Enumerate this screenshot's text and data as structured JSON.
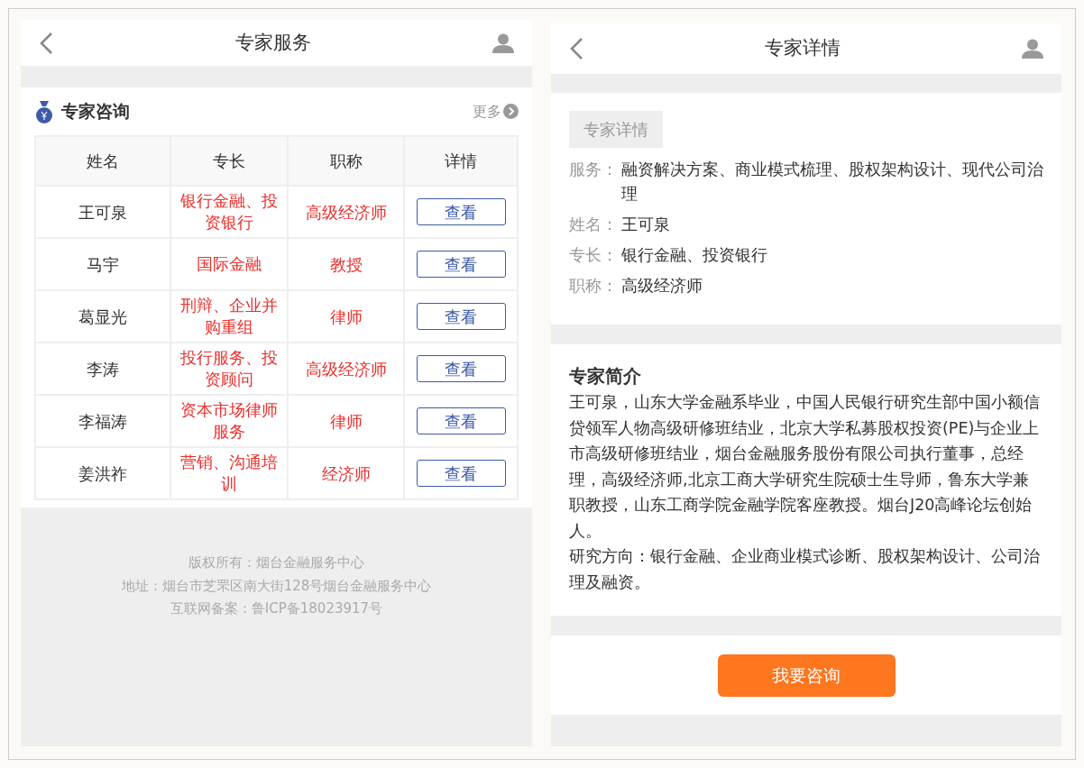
{
  "list_screen": {
    "header": {
      "title": "专家服务"
    },
    "section": {
      "title": "专家咨询",
      "more": "更多"
    },
    "table": {
      "columns": [
        "姓名",
        "专长",
        "职称",
        "详情"
      ],
      "rows": [
        {
          "name": "王可泉",
          "specialty": "银行金融、投资银行",
          "title": "高级经济师",
          "action": "查看"
        },
        {
          "name": "马宇",
          "specialty": "国际金融",
          "title": "教授",
          "action": "查看"
        },
        {
          "name": "葛显光",
          "specialty": "刑辩、企业并购重组",
          "title": "律师",
          "action": "查看"
        },
        {
          "name": "李涛",
          "specialty": "投行服务、投资顾问",
          "title": "高级经济师",
          "action": "查看"
        },
        {
          "name": "李福涛",
          "specialty": "资本市场律师服务",
          "title": "律师",
          "action": "查看"
        },
        {
          "name": "姜洪祚",
          "specialty": "营销、沟通培训",
          "title": "经济师",
          "action": "查看"
        }
      ]
    },
    "footer": [
      "版权所有：烟台金融服务中心",
      "地址：烟台市芝罘区南大街128号烟台金融服务中心",
      "互联网备案：鲁ICP备18023917号"
    ]
  },
  "detail_screen": {
    "header": {
      "title": "专家详情"
    },
    "tag": "专家详情",
    "fields": [
      {
        "label": "服务：",
        "value": "融资解决方案、商业模式梳理、股权架构设计、现代公司治理"
      },
      {
        "label": "姓名：",
        "value": "王可泉"
      },
      {
        "label": "专长：",
        "value": "银行金融、投资银行"
      },
      {
        "label": "职称：",
        "value": "高级经济师"
      }
    ],
    "intro": {
      "title": "专家简介",
      "paragraphs": [
        "王可泉，山东大学金融系毕业，中国人民银行研究生部中国小额信贷领军人物高级研修班结业，北京大学私募股权投资(PE)与企业上市高级研修班结业，烟台金融服务股份有限公司执行董事，总经理，高级经济师,北京工商大学研究生院硕士生导师，鲁东大学兼职教授，山东工商学院金融学院客座教授。烟台J20高峰论坛创始人。",
        "研究方向：银行金融、企业商业模式诊断、股权架构设计、公司治理及融资。"
      ]
    },
    "button": "我要咨询"
  }
}
